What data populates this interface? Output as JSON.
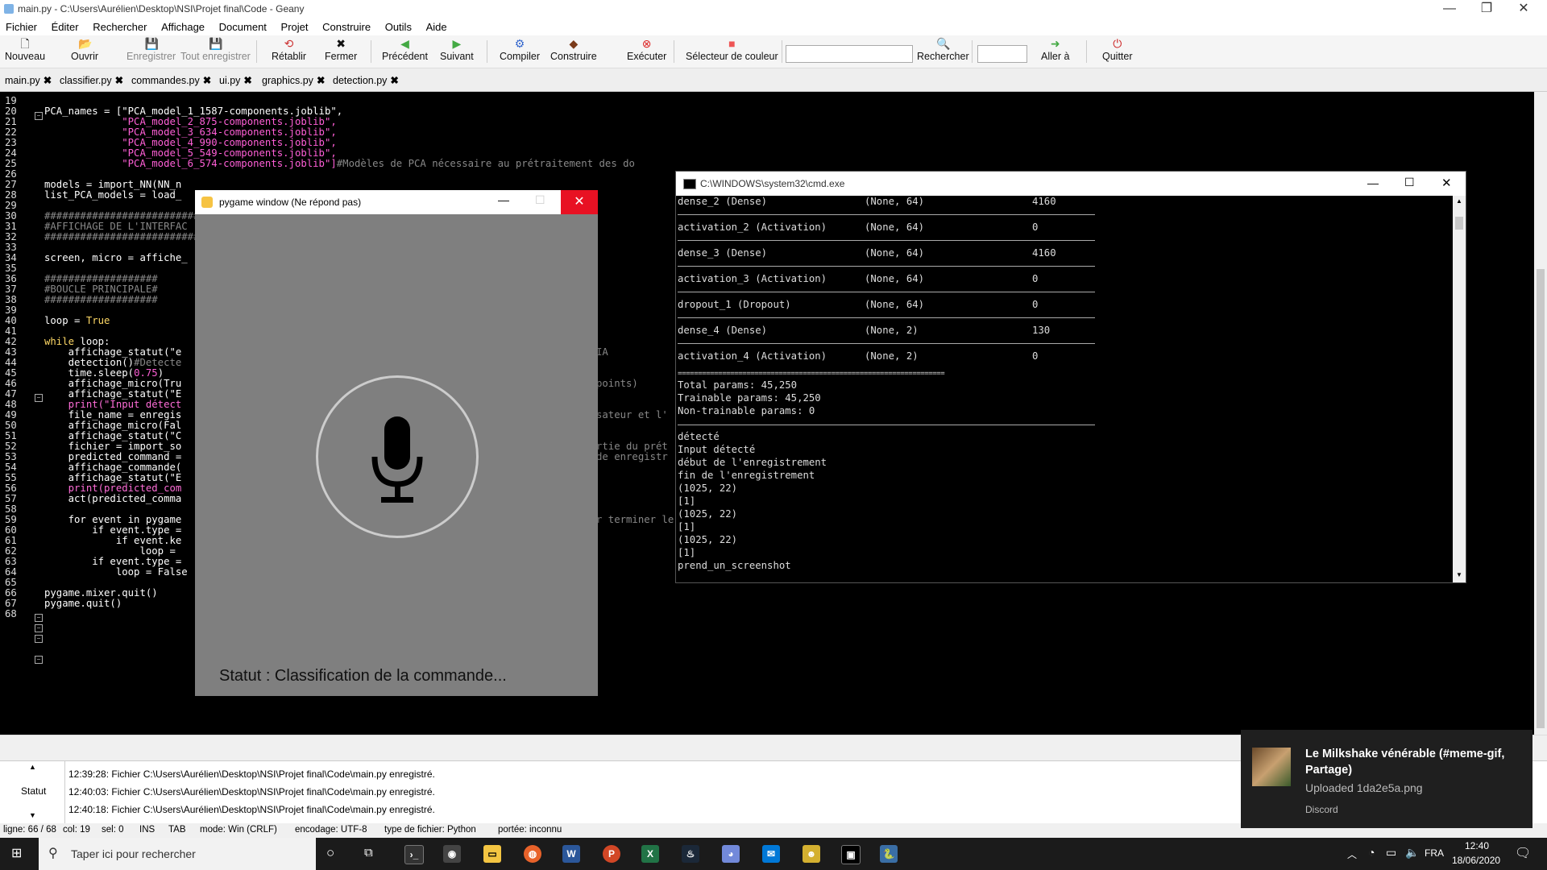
{
  "geany": {
    "title": "main.py - C:\\Users\\Aurélien\\Desktop\\NSI\\Projet final\\Code - Geany",
    "menu": [
      "Fichier",
      "Éditer",
      "Rechercher",
      "Affichage",
      "Document",
      "Projet",
      "Construire",
      "Outils",
      "Aide"
    ],
    "toolbar": {
      "nouveau": "Nouveau",
      "ouvrir": "Ouvrir",
      "enregistrer": "Enregistrer",
      "tout_enregistrer": "Tout enregistrer",
      "retablir": "Rétablir",
      "fermer": "Fermer",
      "precedent": "Précédent",
      "suivant": "Suivant",
      "compiler": "Compiler",
      "construire": "Construire",
      "executer": "Exécuter",
      "selecteur": "Sélecteur de couleur",
      "rechercher": "Rechercher",
      "aller": "Aller à",
      "quitter": "Quitter"
    },
    "tabs": [
      "main.py",
      "classifier.py",
      "commandes.py",
      "ui.py",
      "graphics.py",
      "detection.py"
    ],
    "line_numbers": [
      "19",
      "20",
      "21",
      "22",
      "23",
      "24",
      "25",
      "26",
      "27",
      "28",
      "29",
      "30",
      "31",
      "32",
      "33",
      "34",
      "35",
      "36",
      "37",
      "38",
      "39",
      "40",
      "41",
      "42",
      "43",
      "44",
      "45",
      "46",
      "47",
      "48",
      "49",
      "50",
      "51",
      "52",
      "53",
      "54",
      "55",
      "56",
      "57",
      "58",
      "59",
      "60",
      "61",
      "62",
      "63",
      "64",
      "65",
      "66",
      "67",
      "68"
    ],
    "code": {
      "l20": "PCA_names = [\"PCA_model_1_1587-components.joblib\",",
      "l21": "             \"PCA_model_2_875-components.joblib\",",
      "l22": "             \"PCA_model_3_634-components.joblib\",",
      "l23": "             \"PCA_model_4_990-components.joblib\",",
      "l24": "             \"PCA_model_5_549-components.joblib\",",
      "l25a": "             \"PCA_model_6_574-components.joblib\"]",
      "l25b": "#Modèles de PCA nécessaire au prétraitement des do",
      "l27": "models = import_NN(NN_n",
      "l28": "list_PCA_models = load_",
      "l30": "##########################",
      "l31": "#AFFICHAGE DE L'INTERFAC",
      "l32": "##########################",
      "l34": "screen, micro = affiche_",
      "l36": "###################",
      "l37": "#BOUCLE PRINCIPALE#",
      "l38": "###################",
      "l40a": "loop = ",
      "l40b": "True",
      "l42a": "while",
      "l42b": " loop:",
      "l43": "    affichage_statut(\"e",
      "l44a": "    detection()",
      "l44b": "#Detecte",
      "l45a": "    time.sleep(",
      "l45b": "0.75",
      "l45c": ")",
      "l46": "    affichage_micro(Tru",
      "l47": "    affichage_statut(\"E",
      "l48": "    print(\"Input détect",
      "l49": "    file_name = enregis",
      "l50": "    affichage_micro(Fal",
      "l51": "    affichage_statut(\"C",
      "l52": "    fichier = import_so",
      "l53": "    predicted_command =",
      "l54": "    affichage_commande(",
      "l55": "    affichage_statut(\"E",
      "l56": "    print(predicted_com",
      "l57": "    act(predicted_comma",
      "l59": "    for event in pygame",
      "l60": "        if event.type =",
      "l61": "            if event.ke",
      "l62": "                loop = ",
      "l63": "        if event.type =",
      "l64": "            loop = False",
      "l66": "pygame.mixer.quit()",
      "l67": "pygame.quit()",
      "r43": "IA",
      "r46": "points)",
      "r48": "sateur et l'",
      "r52": "rtie du prét",
      "r53": "de enregistr",
      "r59": "r terminer le programme proprement"
    },
    "messages": [
      "12:39:28: Fichier C:\\Users\\Aurélien\\Desktop\\NSI\\Projet final\\Code\\main.py enregistré.",
      "12:40:03: Fichier C:\\Users\\Aurélien\\Desktop\\NSI\\Projet final\\Code\\main.py enregistré.",
      "12:40:18: Fichier C:\\Users\\Aurélien\\Desktop\\NSI\\Projet final\\Code\\main.py enregistré."
    ],
    "msg_tab": "Statut",
    "status": {
      "ligne": "ligne: 66 / 68",
      "col": "col: 19",
      "sel": "sel: 0",
      "ins": "INS",
      "tab": "TAB",
      "mode": "mode: Win (CRLF)",
      "enc": "encodage: UTF-8",
      "type": "type de fichier: Python",
      "portee": "portée: inconnu"
    }
  },
  "pygame": {
    "title": "pygame window (Ne répond pas)",
    "status": "Statut : Classification de la commande..."
  },
  "cmd": {
    "title": "C:\\WINDOWS\\system32\\cmd.exe",
    "rows": [
      [
        "dense_2 (Dense)",
        "(None, 64)",
        "4160"
      ],
      [
        "activation_2 (Activation)",
        "(None, 64)",
        "0"
      ],
      [
        "dense_3 (Dense)",
        "(None, 64)",
        "4160"
      ],
      [
        "activation_3 (Activation)",
        "(None, 64)",
        "0"
      ],
      [
        "dropout_1 (Dropout)",
        "(None, 64)",
        "0"
      ],
      [
        "dense_4 (Dense)",
        "(None, 2)",
        "130"
      ],
      [
        "activation_4 (Activation)",
        "(None, 2)",
        "0"
      ]
    ],
    "separator": "==================================================================",
    "lines": [
      "Total params: 45,250",
      "Trainable params: 45,250",
      "Non-trainable params: 0",
      "",
      "détecté",
      "Input détecté",
      "début de l'enregistrement",
      "fin de l'enregistrement",
      "(1025, 22)",
      "[1]",
      "(1025, 22)",
      "[1]",
      "(1025, 22)",
      "[1]",
      "prend_un_screenshot"
    ]
  },
  "toast": {
    "title": "Le Milkshake vénérable (#meme-gif, Partage)",
    "body": "Uploaded 1da2e5a.png",
    "app": "Discord"
  },
  "taskbar": {
    "search_placeholder": "Taper ici pour rechercher",
    "lang": "FRA",
    "time": "12:40",
    "date": "18/06/2020"
  }
}
